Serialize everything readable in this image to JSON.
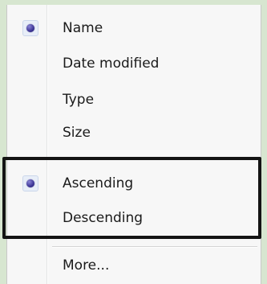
{
  "menu": {
    "sort_items": [
      {
        "label": "Name",
        "selected": true
      },
      {
        "label": "Date modified",
        "selected": false
      },
      {
        "label": "Type",
        "selected": false
      },
      {
        "label": "Size",
        "selected": false
      }
    ],
    "order_items": [
      {
        "label": "Ascending",
        "selected": true
      },
      {
        "label": "Descending",
        "selected": false
      }
    ],
    "more_label": "More..."
  },
  "colors": {
    "background": "#d7e6d0",
    "menu_background": "#f7f7f7",
    "radio_dot": "#3d3596",
    "highlight_border": "#141414"
  },
  "icons": {
    "selected_marker": "radio-dot-icon"
  }
}
